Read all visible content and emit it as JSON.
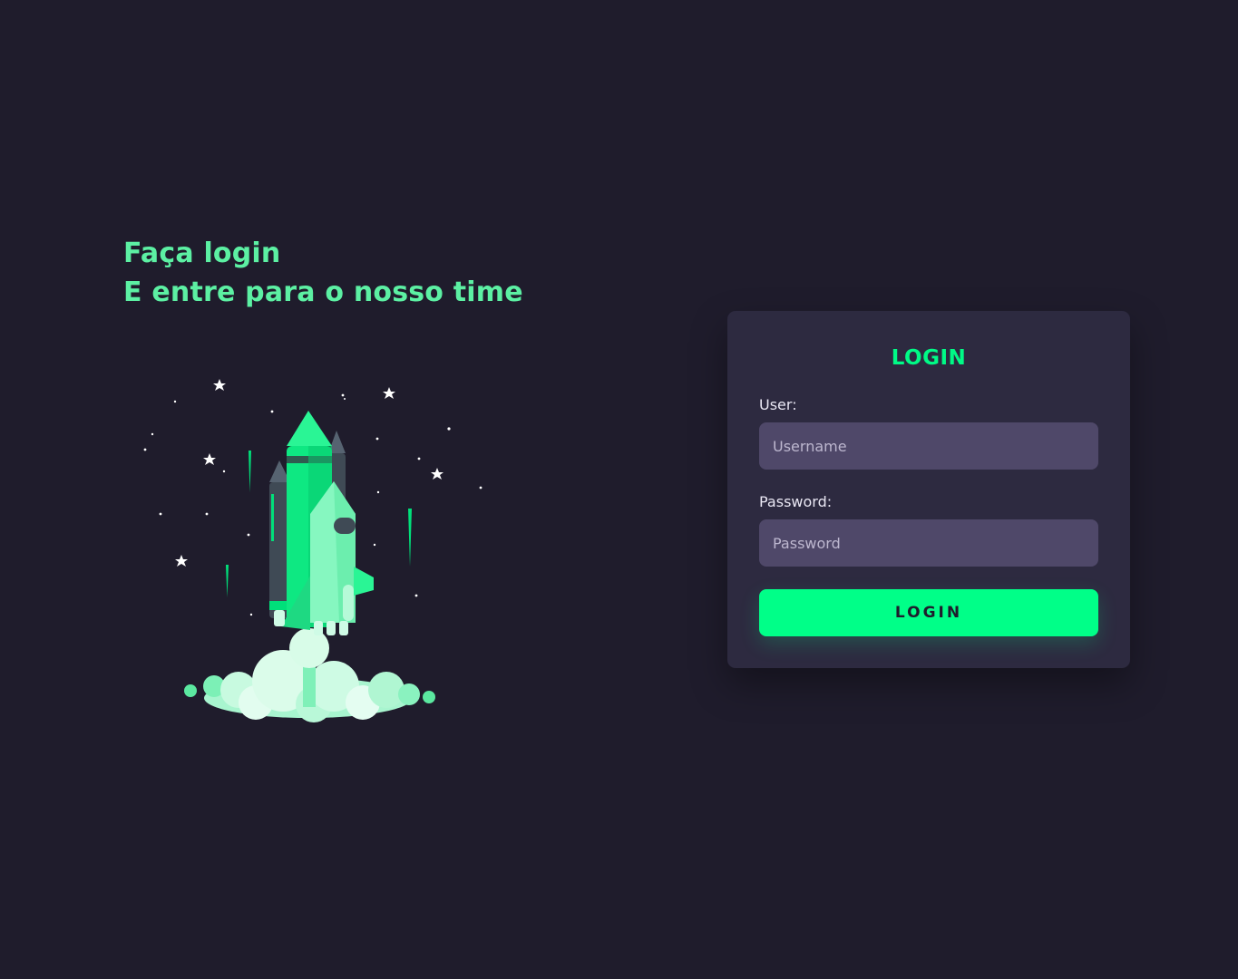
{
  "hero": {
    "line1": "Faça login",
    "line2": "E entre para o nosso time",
    "accent_color": "#5cf0a3"
  },
  "illustration": {
    "icon": "rocket-launch-illustration"
  },
  "login_card": {
    "title": "LOGIN",
    "user_label": "User:",
    "user_placeholder": "Username",
    "user_value": "",
    "password_label": "Password:",
    "password_placeholder": "Password",
    "password_value": "",
    "submit_label": "LOGIN",
    "accent_color": "#00ff88"
  },
  "colors": {
    "background": "#1f1c2c",
    "card": "#2d2a40",
    "input": "#4f4869"
  }
}
